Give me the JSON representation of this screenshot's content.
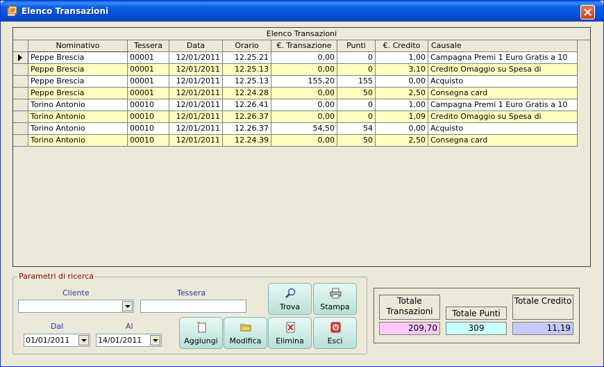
{
  "window": {
    "title": "Elenco Transazioni"
  },
  "grid": {
    "caption": "Elenco Transazioni",
    "columns": [
      "Nominativo",
      "Tessera",
      "Data",
      "Orario",
      "€. Transazione",
      "Punti",
      "€. Credito",
      "Causale"
    ],
    "rows": [
      [
        "Peppe Brescia",
        "00001",
        "12/01/2011",
        "12.25.21",
        "0,00",
        "0",
        "1,00",
        "Campagna Premi 1 Euro Gratis a 10"
      ],
      [
        "Peppe Brescia",
        "00001",
        "12/01/2011",
        "12.25.13",
        "0,00",
        "0",
        "3,10",
        "Credito Omaggio su Spesa di"
      ],
      [
        "Peppe Brescia",
        "00001",
        "12/01/2011",
        "12.25.13",
        "155,20",
        "155",
        "0,00",
        "Acquisto"
      ],
      [
        "Peppe Brescia",
        "00001",
        "12/01/2011",
        "12.24.28",
        "0,00",
        "50",
        "2,50",
        "Consegna card"
      ],
      [
        "Torino Antonio",
        "00010",
        "12/01/2011",
        "12.26.41",
        "0,00",
        "0",
        "1,00",
        "Campagna Premi 1 Euro Gratis a 10"
      ],
      [
        "Torino Antonio",
        "00010",
        "12/01/2011",
        "12.26.37",
        "0,00",
        "0",
        "1,09",
        "Credito Omaggio su Spesa di"
      ],
      [
        "Torino Antonio",
        "00010",
        "12/01/2011",
        "12.26.37",
        "54,50",
        "54",
        "0,00",
        "Acquisto"
      ],
      [
        "Torino Antonio",
        "00010",
        "12/01/2011",
        "12.24.39",
        "0,00",
        "50",
        "2,50",
        "Consegna card"
      ]
    ]
  },
  "search": {
    "legend": "Parametri di ricerca",
    "cliente_label": "Cliente",
    "cliente_value": "",
    "tessera_label": "Tessera",
    "tessera_value": "",
    "dal_label": "Dal",
    "dal_value": "01/01/2011",
    "al_label": "Al",
    "al_value": "14/01/2011"
  },
  "buttons": {
    "trova": "Trova",
    "stampa": "Stampa",
    "aggiungi": "Aggiungi",
    "modifica": "Modifica",
    "elimina": "Elimina",
    "esci": "Esci"
  },
  "totals": {
    "transazioni_label": "Totale Transazioni",
    "transazioni_value": "209,70",
    "punti_label": "Totale Punti",
    "punti_value": "309",
    "credito_label": "Totale Credito",
    "credito_value": "11,19"
  },
  "colors": {
    "row_white": "#ffffff",
    "row_yellow": "#ffffc0",
    "tot_transazioni_bg": "#ffc8ff",
    "tot_punti_bg": "#c8ffff",
    "tot_credito_bg": "#c8c8ff"
  }
}
